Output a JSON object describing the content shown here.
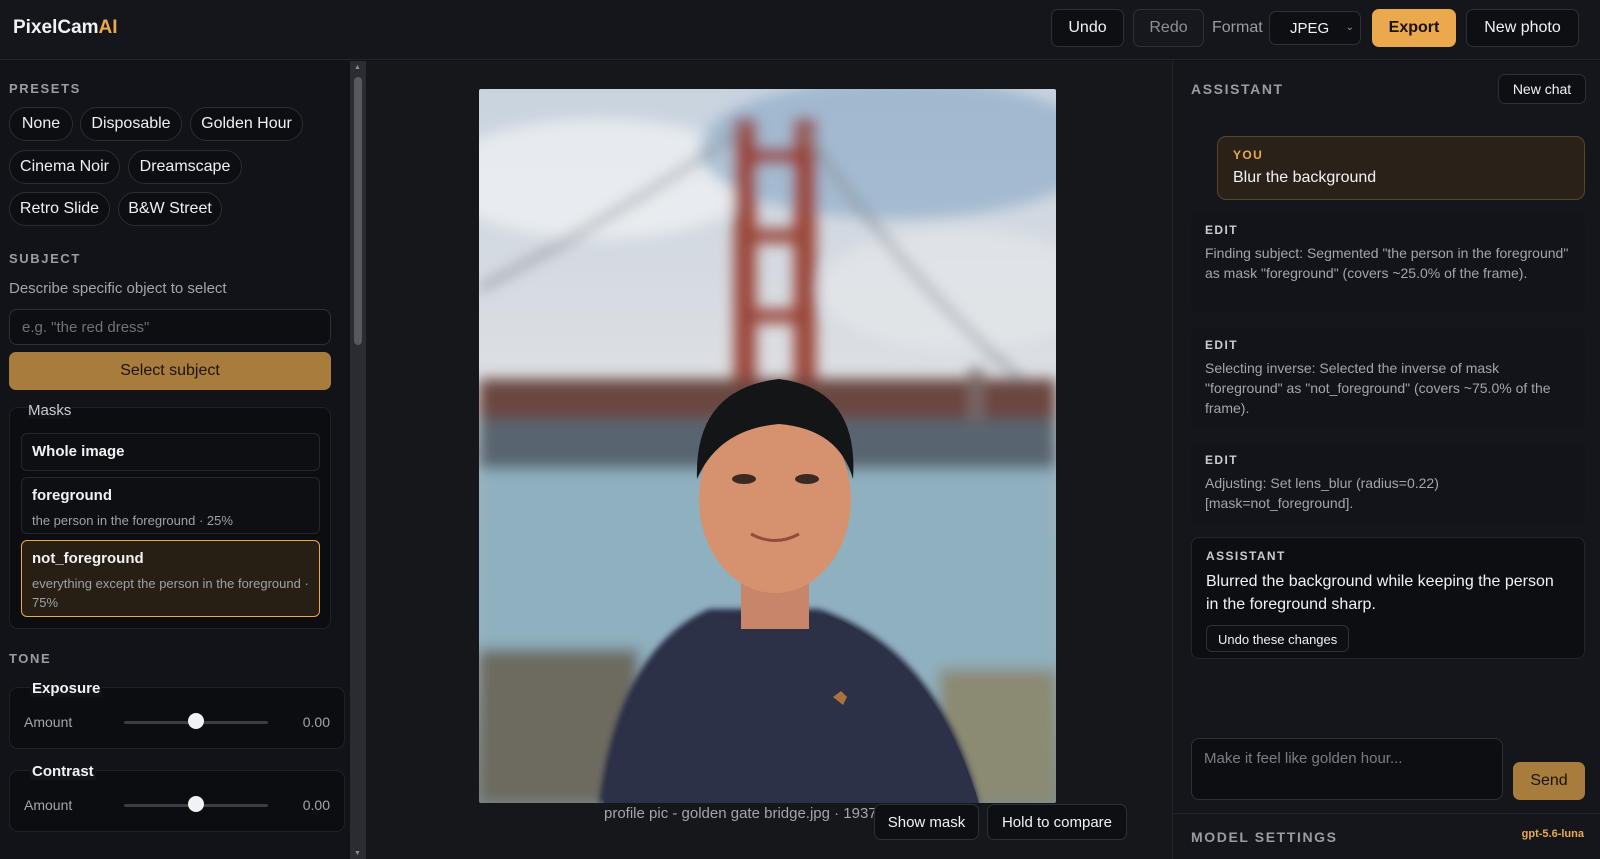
{
  "app": {
    "name": "PixelCam",
    "name_accent": "AI"
  },
  "toolbar": {
    "undo_label": "Undo",
    "redo_label": "Redo",
    "format_label": "Format",
    "format_value": "JPEG",
    "export_label": "Export",
    "new_photo_label": "New photo"
  },
  "presets": {
    "title": "PRESETS",
    "items": [
      "None",
      "Disposable",
      "Golden Hour",
      "Cinema Noir",
      "Dreamscape",
      "Retro Slide",
      "B&W Street"
    ]
  },
  "subject": {
    "title": "SUBJECT",
    "hint": "Describe specific object to select",
    "placeholder": "e.g. \"the red dress\"",
    "select_label": "Select subject"
  },
  "masks": {
    "title": "Masks",
    "items": [
      {
        "name": "Whole image",
        "desc": ""
      },
      {
        "name": "foreground",
        "desc": "the person in the foreground · 25%"
      },
      {
        "name": "not_foreground",
        "desc": "everything except the person in the foreground · 75%",
        "active": true
      }
    ]
  },
  "tone": {
    "title": "TONE",
    "controls": [
      {
        "name": "Exposure",
        "amount_label": "Amount",
        "value": "0.00",
        "level": 0.5
      },
      {
        "name": "Contrast",
        "amount_label": "Amount",
        "value": "0.00",
        "level": 0.5
      }
    ]
  },
  "canvas": {
    "caption": "profile pic - golden gate bridge.jpg · 1937×",
    "show_mask_label": "Show mask",
    "compare_label": "Hold to compare"
  },
  "assistant": {
    "title": "ASSISTANT",
    "new_chat_label": "New chat",
    "user_message": {
      "who": "YOU",
      "text": "Blur the background"
    },
    "edits": [
      {
        "who": "EDIT",
        "text": "Finding subject: Segmented \"the person in the foreground\" as mask \"foreground\" (covers ~25.0% of the frame)."
      },
      {
        "who": "EDIT",
        "text": "Selecting inverse: Selected the inverse of mask \"foreground\" as \"not_foreground\" (covers ~75.0% of the frame)."
      },
      {
        "who": "EDIT",
        "text": "Adjusting: Set lens_blur (radius=0.22) [mask=not_foreground]."
      }
    ],
    "reply": {
      "who": "ASSISTANT",
      "text": "Blurred the background while keeping the person in the foreground sharp.",
      "undo_label": "Undo these changes"
    },
    "input_placeholder": "Make it feel like golden hour...",
    "send_label": "Send",
    "model_settings_title": "MODEL SETTINGS",
    "model_name": "gpt-5.6-luna"
  },
  "colors": {
    "accent": "#e9a94c",
    "accent_dark": "#a87c3c",
    "background": "#111318"
  }
}
